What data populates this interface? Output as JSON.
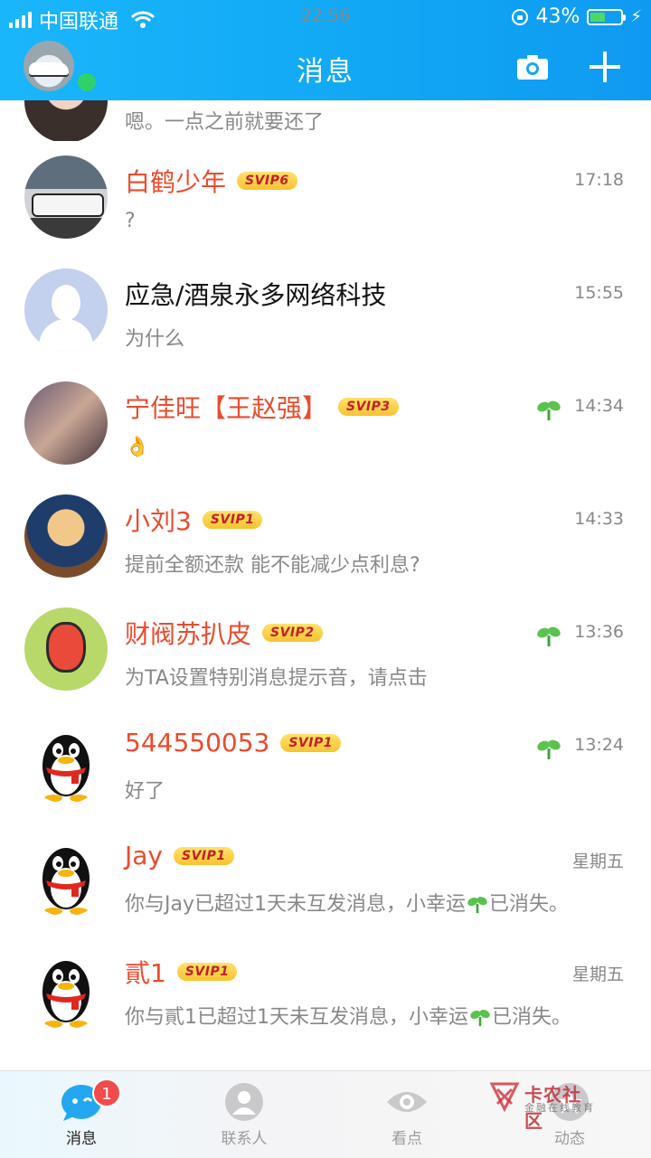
{
  "status_bar": {
    "carrier": "中国联通",
    "time": "22:56",
    "battery": "43%"
  },
  "header": {
    "title": "消息"
  },
  "conversations": [
    {
      "name": "",
      "preview": "嗯。一点之前就要还了",
      "time": "",
      "badge": "",
      "sprout": false
    },
    {
      "name": "白鹤少年",
      "preview": "?",
      "time": "17:18",
      "badge": "SVIP6",
      "sprout": false
    },
    {
      "name": "应急/酒泉永多网络科技",
      "preview": "为什么",
      "time": "15:55",
      "badge": "",
      "sprout": false
    },
    {
      "name": "宁佳旺【王赵强】",
      "preview": "👌",
      "time": "14:34",
      "badge": "SVIP3",
      "sprout": true
    },
    {
      "name": "小刘3",
      "preview": "提前全额还款 能不能减少点利息?",
      "time": "14:33",
      "badge": "SVIP1",
      "sprout": false
    },
    {
      "name": "财阀苏扒皮",
      "preview": "为TA设置特别消息提示音，请点击",
      "time": "13:36",
      "badge": "SVIP2",
      "sprout": true
    },
    {
      "name": "544550053",
      "preview": "好了",
      "time": "13:24",
      "badge": "SVIP1",
      "sprout": true
    },
    {
      "name": "Jay",
      "preview_before": "你与Jay已超过1天未互发消息，小幸运",
      "preview_after": "已消失。",
      "time": "星期五",
      "badge": "SVIP1",
      "sprout": false
    },
    {
      "name": "貳1",
      "preview_before": "你与貳1已超过1天未互发消息，小幸运",
      "preview_after": "已消失。",
      "time": "星期五",
      "badge": "SVIP1",
      "sprout": false
    }
  ],
  "tabs": [
    {
      "label": "消息",
      "badge": "1",
      "icon": "chat-bubble-icon",
      "active": true
    },
    {
      "label": "联系人",
      "icon": "contacts-icon",
      "active": false
    },
    {
      "label": "看点",
      "icon": "eye-icon",
      "active": false
    },
    {
      "label": "动态",
      "icon": "star-icon",
      "active": false
    }
  ],
  "watermark": {
    "title": "卡农社区",
    "subtitle": "金融在线教育"
  }
}
